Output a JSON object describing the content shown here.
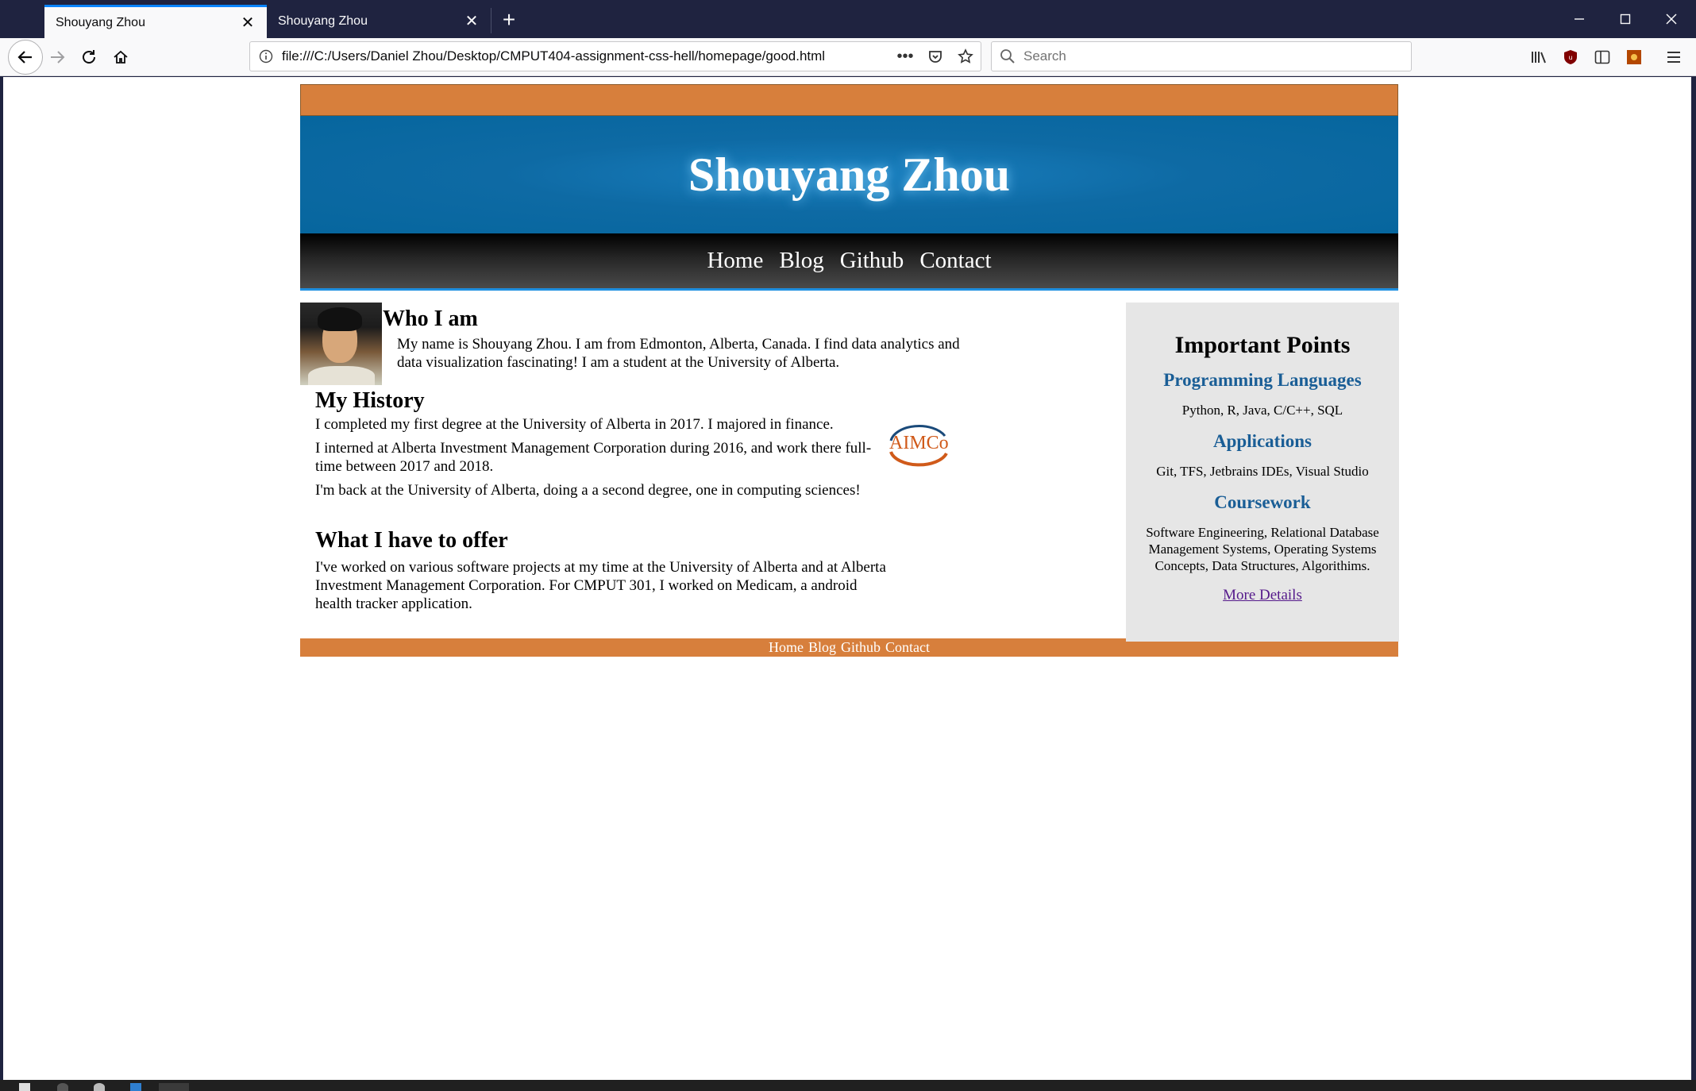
{
  "browser": {
    "tabs": [
      {
        "title": "Shouyang Zhou",
        "active": true
      },
      {
        "title": "Shouyang Zhou",
        "active": false
      }
    ],
    "url": "file:///C:/Users/Daniel Zhou/Desktop/CMPUT404-assignment-css-hell/homepage/good.html",
    "search_placeholder": "Search",
    "icons": [
      "back-icon",
      "forward-icon",
      "reload-icon",
      "home-icon",
      "info-icon",
      "page-actions-icon",
      "pocket-icon",
      "bookmark-star-icon",
      "search-icon",
      "library-icon",
      "ublock-icon",
      "sidebar-icon",
      "extension-icon",
      "menu-icon",
      "minimize-icon",
      "maximize-icon",
      "close-icon"
    ]
  },
  "site": {
    "title": "Shouyang Zhou",
    "menu": [
      "Home",
      "Blog",
      "Github",
      "Contact"
    ],
    "colors": {
      "orange": "#d77f3c",
      "blue": "#06669e",
      "sidebar_bg": "#e6e6e6",
      "heading_blue": "#1a5e96",
      "link_visited": "#551a8b"
    }
  },
  "main": {
    "who": {
      "heading": "Who I am",
      "text": "My name is Shouyang Zhou. I am from Edmonton, Alberta, Canada. I find data analytics and data visualization fascinating! I am a student at the University of Alberta."
    },
    "history": {
      "heading": "My History",
      "paragraphs": [
        "I completed my first degree at the University of Alberta in 2017. I majored in finance.",
        "I interned at Alberta Investment Management Corporation during 2016, and work there full-time between 2017 and 2018.",
        "I'm back at the University of Alberta, doing a a second degree, one in computing sciences!"
      ],
      "logo_text": "AIMCo"
    },
    "offer": {
      "heading": "What I have to offer",
      "text": "I've worked on various software projects at my time at the University of Alberta and at Alberta Investment Management Corporation. For CMPUT 301, I worked on Medicam, a android health tracker application."
    }
  },
  "aside": {
    "heading": "Important Points",
    "sections": [
      {
        "title": "Programming Languages",
        "text": "Python, R, Java, C/C++, SQL"
      },
      {
        "title": "Applications",
        "text": "Git, TFS, Jetbrains IDEs, Visual Studio"
      },
      {
        "title": "Coursework",
        "text": "Software Engineering, Relational Database Management Systems, Operating Systems Concepts, Data Structures, Algorithims."
      }
    ],
    "link": "More Details"
  },
  "footer": {
    "links": [
      "Home",
      "Blog",
      "Github",
      "Contact"
    ]
  }
}
